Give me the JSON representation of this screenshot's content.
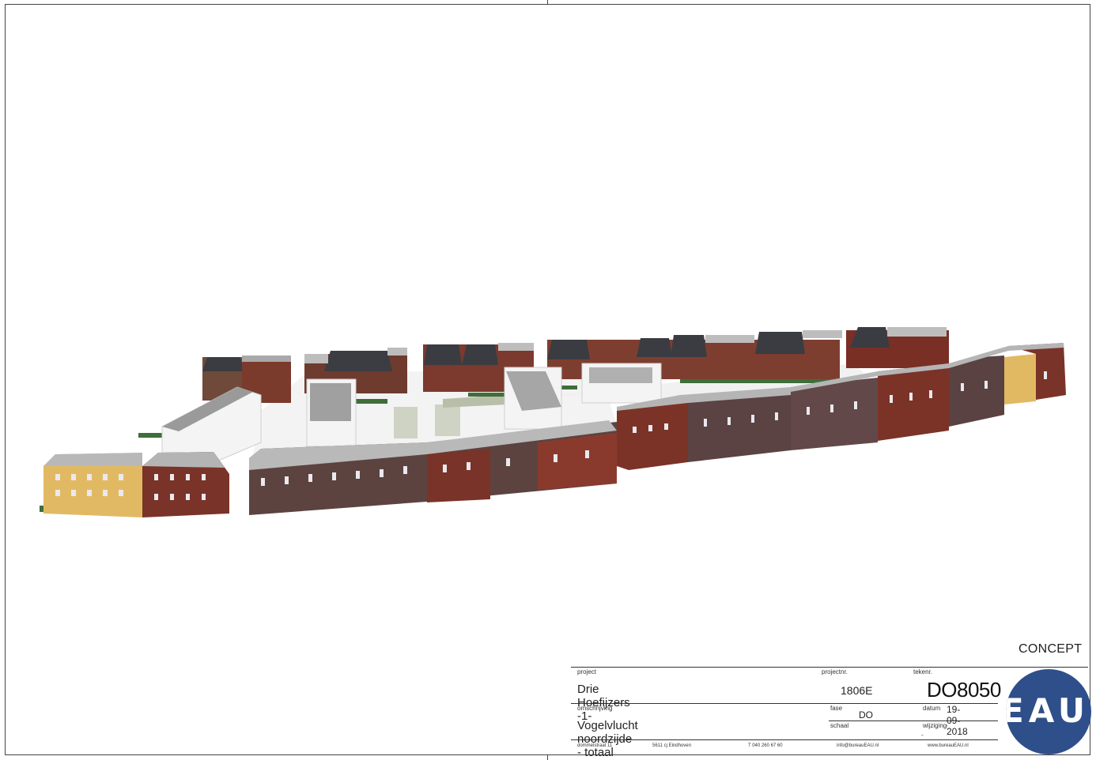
{
  "concept": "CONCEPT",
  "titleblock": {
    "project_label": "project",
    "project": "Drie Hoefijzers -1-",
    "projectnr_label": "projectnr.",
    "projectnr": "1806E",
    "tekenr_label": "tekenr.",
    "tekenr": "DO8050",
    "omschrijving_label": "omschrijving",
    "omschrijving": "Vogelvlucht noordzijde - totaal",
    "fase_label": "fase",
    "fase": "DO",
    "datum_label": "datum",
    "datum": "19-09-2018",
    "schaal_label": "schaal",
    "wijziging_label": "wijziging",
    "wijziging": "-",
    "wijziging_dash": "-",
    "address": "dommelstraat 11",
    "city": "5611 cj Eindhoven",
    "phone": "T 040 260 67 60",
    "email": "info@bureauEAU.nl",
    "web": "www.bureauEAU.nl"
  },
  "logo": {
    "text": "EAU",
    "color": "#2f4f8a"
  }
}
